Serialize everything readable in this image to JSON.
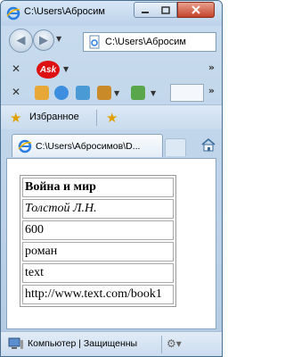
{
  "window": {
    "title": "C:\\Users\\Абросим",
    "min_icon": "minimize-icon",
    "max_icon": "maximize-icon",
    "close_icon": "close-icon"
  },
  "address": {
    "url": "C:\\Users\\Абросим"
  },
  "toolbar": {
    "close_glyph": "✕",
    "ask_logo_text": "Ask",
    "chevron": "»"
  },
  "favorites": {
    "label": "Избранное"
  },
  "tab": {
    "label": "C:\\Users\\Абросимов\\D..."
  },
  "table": {
    "rows": [
      "Война и мир",
      "Толстой Л.Н.",
      "600",
      "роман",
      "text",
      "http://www.text.com/book1"
    ]
  },
  "status": {
    "text": "Компьютер | Защищенны"
  },
  "colors": {
    "frame": "#b4cbe3",
    "accent": "#4a6e8e",
    "close_button": "#c4442a"
  }
}
